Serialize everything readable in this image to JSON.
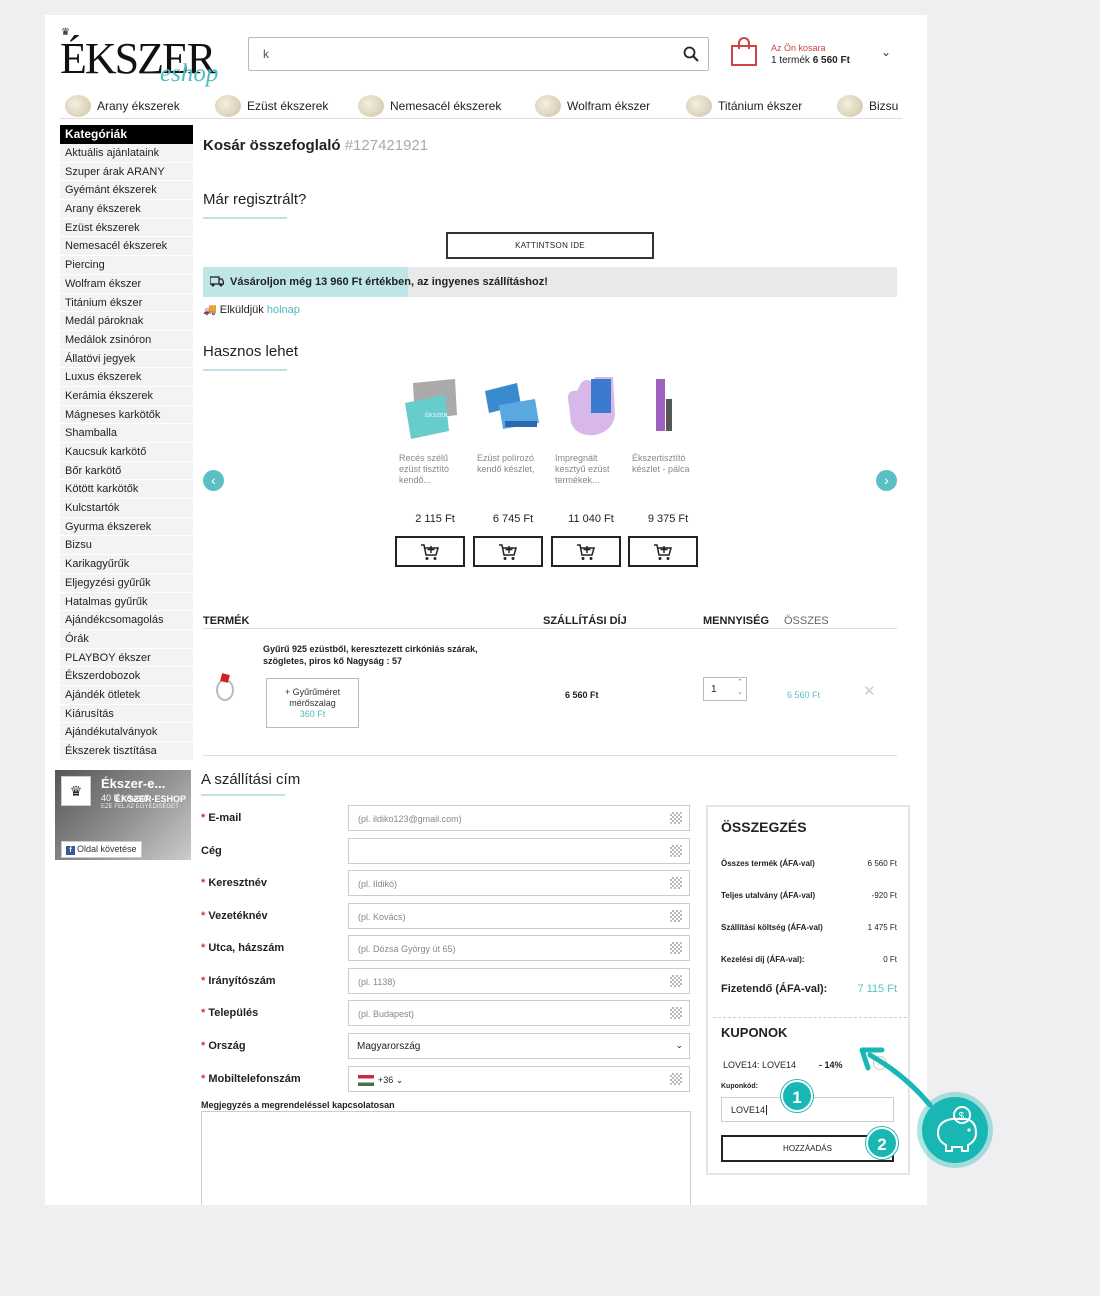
{
  "header": {
    "logo_main": "ÉKSZER",
    "logo_sub": "eshop",
    "search_value": "k",
    "cart_title": "Az Ön kosara",
    "cart_count": "1 termék",
    "cart_total": "6 560 Ft"
  },
  "category_nav": [
    "Arany ékszerek",
    "Ezüst ékszerek",
    "Nemesacél ékszerek",
    "Wolfram ékszer",
    "Titánium ékszer",
    "Bizsu"
  ],
  "sidebar": {
    "title": "Kategóriák",
    "items": [
      "Aktuális ajánlataink",
      "Szuper árak ARANY",
      "Gyémánt ékszerek",
      "Arany ékszerek",
      "Ezüst ékszerek",
      "Nemesacél ékszerek",
      "Piercing",
      "Wolfram ékszer",
      "Titánium ékszer",
      "Medál pároknak",
      "Medálok zsinóron",
      "Állatövi jegyek",
      "Luxus ékszerek",
      "Kerámia ékszerek",
      "Mágneses karkötők",
      "Shamballa",
      "Kaucsuk karkötő",
      "Bőr karkötő",
      "Kötött karkötők",
      "Kulcstartók",
      "Gyurma ékszerek",
      "Bizsu",
      "Karikagyűrűk",
      "Eljegyzési gyűrűk",
      "Hatalmas gyűrűk",
      "Ajándékcsomagolás",
      "Órák",
      "PLAYBOY ékszer",
      "Ékszerdobozok",
      "Ajándék ötletek",
      "Kiárusítás",
      "Ajándékutalványok",
      "Ékszerek tisztítása"
    ]
  },
  "facebook": {
    "name": "Ékszer-e...",
    "followers": "40 E követő",
    "brand": "ÉKSZER-ESHOP",
    "tagline": "EZE FEL AZ EGYEDISÉGET",
    "follow_label": "Oldal követése"
  },
  "cart": {
    "title": "Kosár összefoglaló",
    "order_number": "#127421921",
    "registered_heading": "Már regisztrált?",
    "click_here": "KATTINTSON IDE",
    "free_shipping": "Vásároljon még 13 960 Ft értékben, az ingyenes szállításhoz!",
    "send_prefix": "Elküldjük",
    "send_when": "holnap",
    "useful_heading": "Hasznos lehet"
  },
  "suggested": [
    {
      "name": "Recés szélű ezüst tisztító kendő...",
      "price": "2 115 Ft"
    },
    {
      "name": "Ezüst polírozó kendő készlet,",
      "price": "6 745 Ft"
    },
    {
      "name": "Impregnált kesztyű ezüst termékek...",
      "price": "11 040 Ft"
    },
    {
      "name": "Ékszertisztító készlet - pálca",
      "price": "9 375 Ft"
    }
  ],
  "table": {
    "headers": [
      "TERMÉK",
      "SZÁLLÍTÁSI DÍJ",
      "MENNYISÉG",
      "ÖSSZES"
    ],
    "item": {
      "description": "Gyűrű 925 ezüstből, keresztezett cirkóniás szárak, szögletes, piros kő Nagyság : 57",
      "ring_size_label": "+ Gyűrűméret mérőszalag",
      "ring_size_price": "360 Ft",
      "shipping": "6 560 Ft",
      "quantity": "1",
      "total": "6 560 Ft"
    }
  },
  "shipping_form": {
    "heading": "A szállítási cím",
    "fields": [
      {
        "label": "E-mail",
        "required": "*",
        "placeholder": "(pl. ildiko123@gmail.com)"
      },
      {
        "label": "Cég",
        "required": "",
        "placeholder": ""
      },
      {
        "label": "Keresztnév",
        "required": "*",
        "placeholder": "(pl. Ildikó)"
      },
      {
        "label": "Vezetéknév",
        "required": "*",
        "placeholder": "(pl. Kovács)"
      },
      {
        "label": "Utca, házszám",
        "required": "*",
        "placeholder": "(pl. Dózsa György út 65)"
      },
      {
        "label": "Irányítószám",
        "required": "*",
        "placeholder": "(pl. 1138)"
      },
      {
        "label": "Település",
        "required": "*",
        "placeholder": "(pl. Budapest)"
      }
    ],
    "country_label": "Ország",
    "country_value": "Magyarország",
    "phone_label": "Mobiltelefonszám",
    "phone_prefix": "+36",
    "note_label": "Megjegyzés a megrendeléssel kapcsolatosan"
  },
  "summary": {
    "title": "ÖSSZEGZÉS",
    "rows": [
      {
        "label": "Összes termék (ÁFA-val)",
        "value": "6 560 Ft"
      },
      {
        "label": "Teljes utalvány (ÁFA-val)",
        "value": "-920 Ft"
      },
      {
        "label": "Szállítási költség (ÁFA-val)",
        "value": "1 475 Ft"
      },
      {
        "label": "Kezelési díj (ÁFA-val):",
        "value": "0 Ft"
      }
    ],
    "payable_label": "Fizetendő (ÁFA-val):",
    "payable_value": "7 115 Ft",
    "coupons_title": "KUPONOK",
    "coupon_applied": "LOVE14: LOVE14",
    "coupon_percent": "- 14%",
    "coupon_code_label": "Kuponkód:",
    "coupon_code_value": "LOVE14",
    "add_button": "HOZZÁADÁS"
  },
  "callouts": {
    "step1": "1",
    "step2": "2"
  },
  "colors": {
    "accent": "#5bc0c4",
    "badge": "#18b7b4",
    "required": "#dd3333"
  }
}
